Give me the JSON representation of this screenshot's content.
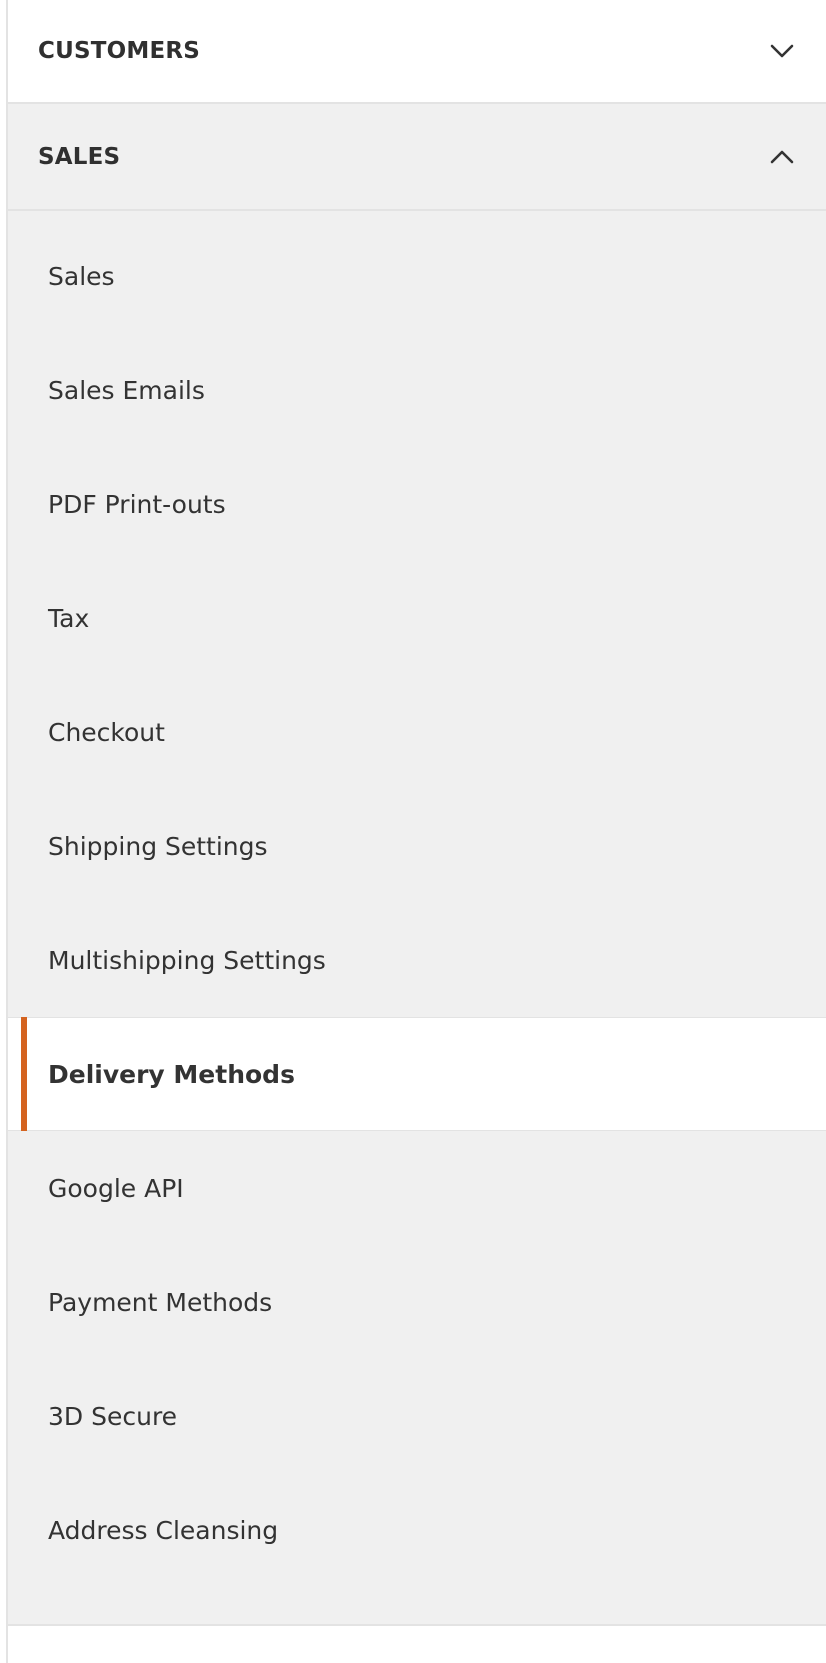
{
  "sections": {
    "customers": {
      "title": "CUSTOMERS",
      "expanded": false,
      "toggle_icon": "chevron-down-icon"
    },
    "sales": {
      "title": "SALES",
      "expanded": true,
      "toggle_icon": "chevron-up-icon",
      "items": [
        {
          "label": "Sales",
          "active": false
        },
        {
          "label": "Sales Emails",
          "active": false
        },
        {
          "label": "PDF Print-outs",
          "active": false
        },
        {
          "label": "Tax",
          "active": false
        },
        {
          "label": "Checkout",
          "active": false
        },
        {
          "label": "Shipping Settings",
          "active": false
        },
        {
          "label": "Multishipping Settings",
          "active": false
        },
        {
          "label": "Delivery Methods",
          "active": true
        },
        {
          "label": "Google API",
          "active": false
        },
        {
          "label": "Payment Methods",
          "active": false
        },
        {
          "label": "3D Secure",
          "active": false
        },
        {
          "label": "Address Cleansing",
          "active": false
        }
      ]
    }
  },
  "colors": {
    "active_indicator": "#d4631f",
    "expanded_background": "#f0f0f0",
    "text": "#333333",
    "divider": "#e3e3e3"
  }
}
